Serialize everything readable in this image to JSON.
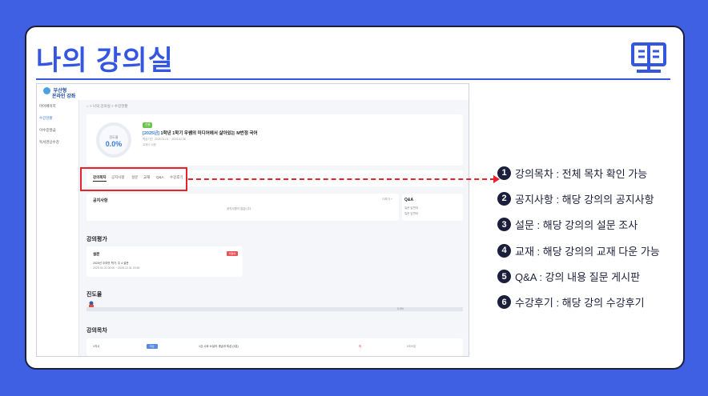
{
  "title": "나의 강의실",
  "icons": {
    "header": "open-book-icon"
  },
  "colors": {
    "background": "#3f60e3",
    "accent": "#3557e0",
    "highlight": "#e4232b",
    "dark": "#1b1f3b"
  },
  "screenshot": {
    "logo_line1": "부산형",
    "logo_line2": "온라인 강좌",
    "sidebar": [
      "마이페이지",
      "수강현황",
      "이수증발급",
      "독서경상수강"
    ],
    "breadcrumb": "⌂ > 나의 강의실 > 수강현황",
    "progress_label": "진도율",
    "progress_value": "0.0%",
    "badge": "진행",
    "course_tag": "[2025년]",
    "course_title": " 1학년 1학기 우쌤의 미디어에서 살아있는 M번정 국어",
    "meta_period_label": "학습기간",
    "meta_period": "2025.01.01 ~ 2025.02.28",
    "meta_row2": "교재   0 시청",
    "tabs": [
      "강의목차",
      "공지사항",
      "설문",
      "교재",
      "Q&A",
      "수강후기"
    ],
    "notice_title": "공지사항",
    "notice_more": "더보기 +",
    "notice_empty": "공지사항이 없습니다.",
    "qa_title": "Q&A",
    "qa_items": [
      "질문 답변대",
      "질문 답변대"
    ],
    "eval_section": "강의평가",
    "survey_title": "설문",
    "survey_btn": "미참여",
    "survey_name": "2025년 우리반 학기, 주 4 설문",
    "survey_date": "2025.01.01 00:00 ~ 2025.12.31 23:59",
    "progress_section": "진도율",
    "progress_bar_value": "0.0%",
    "toc_section": "강의목차",
    "toc_row_no": "1차시",
    "toc_row_btn": "학습",
    "toc_row_title": "1강 시와 소설의 개념과 특성 (3분)",
    "toc_row_status": "미",
    "toc_row_end": "0초/0분"
  },
  "callouts": [
    {
      "num": "1",
      "text": "강의목차 : 전체 목차 확인 가능"
    },
    {
      "num": "2",
      "text": "공지사항 : 해당 강의의 공지사항"
    },
    {
      "num": "3",
      "text": "설문 : 해당 강의의 설문 조사"
    },
    {
      "num": "4",
      "text": "교재 : 해당 강의의 교재 다운 가능"
    },
    {
      "num": "5",
      "text": "Q&A : 강의 내용 질문 게시판"
    },
    {
      "num": "6",
      "text": "수강후기 : 해당 강의 수강후기"
    }
  ]
}
